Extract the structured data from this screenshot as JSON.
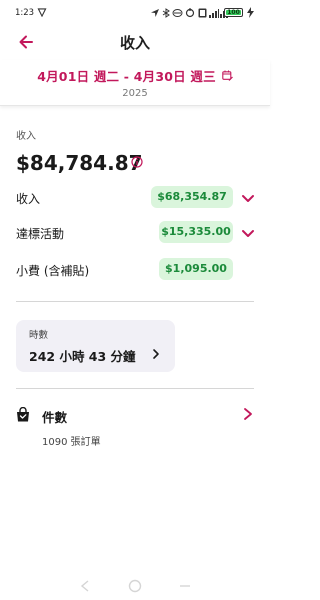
{
  "status_bar": {
    "time": "1:23",
    "battery_percent": "100"
  },
  "app_bar": {
    "title": "收入",
    "back_icon": "arrow-left-icon"
  },
  "date_filter": {
    "range": "4月01日 週二 - 4月30日 週三",
    "year": "2025",
    "calendar_icon": "calendar-edit-icon"
  },
  "earnings": {
    "section_label": "收入",
    "total": "$84,784.87",
    "rows": [
      {
        "label": "收入",
        "amount": "$68,354.87",
        "expandable": true
      },
      {
        "label": "達標活動",
        "amount": "$15,335.00",
        "expandable": true
      },
      {
        "label": "小費 (含補貼)",
        "amount": "$1,095.00",
        "expandable": false
      }
    ]
  },
  "hours": {
    "label": "時數",
    "value": "242 小時 43 分鐘"
  },
  "orders": {
    "title": "件數",
    "count": "1090 張訂單"
  },
  "colors": {
    "accent": "#c2185b",
    "badge_bg": "#daf5dc",
    "badge_text": "#1b8a3a",
    "card_bg": "#f1f0f6"
  }
}
